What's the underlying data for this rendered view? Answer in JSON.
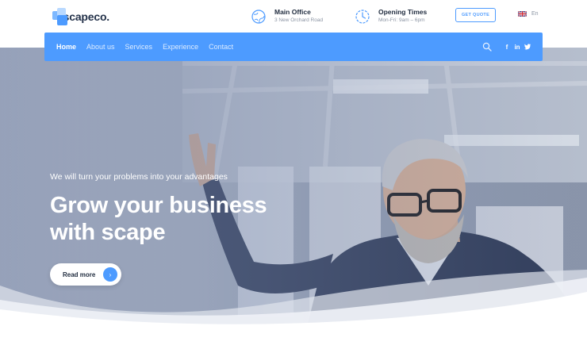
{
  "brand": {
    "name": "scapeco."
  },
  "header": {
    "office": {
      "title": "Main Office",
      "subtitle": "3 New Orchard Road"
    },
    "hours": {
      "title": "Opening Times",
      "subtitle": "Mon-Fri: 9am – 6pm"
    },
    "quote_button": "GET QUOTE",
    "language": "En"
  },
  "nav": {
    "items": [
      {
        "label": "Home"
      },
      {
        "label": "About us"
      },
      {
        "label": "Services"
      },
      {
        "label": "Experience"
      },
      {
        "label": "Contact"
      }
    ],
    "social": {
      "facebook": "f",
      "linkedin": "in"
    }
  },
  "hero": {
    "tagline": "We will turn your problems into your advantages",
    "title_line1": "Grow your business",
    "title_line2": "with scape",
    "button_label": "Read more",
    "button_arrow": "›"
  },
  "colors": {
    "accent": "#4d9bff",
    "text_dark": "#1f2b3e",
    "muted": "#8b94a3"
  }
}
